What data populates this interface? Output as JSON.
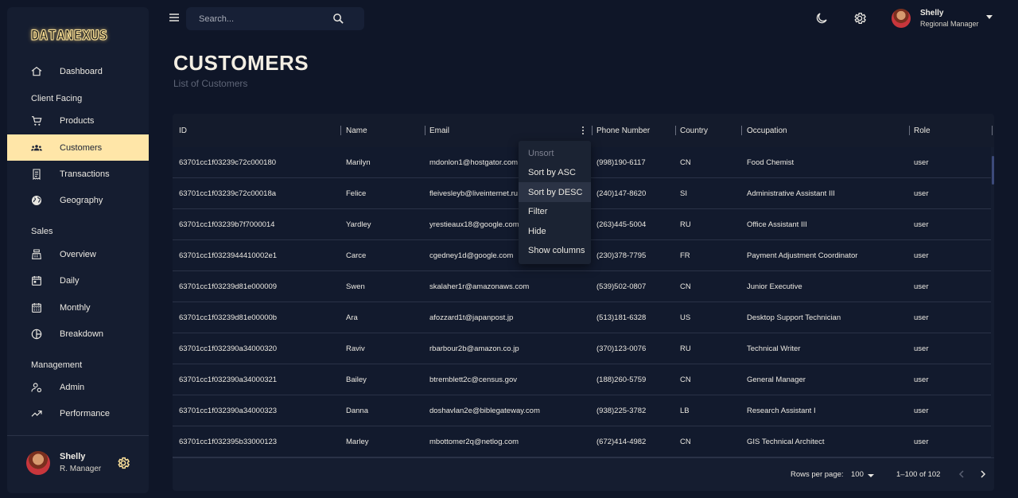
{
  "brand": {
    "logo_text": "DATANEXUS"
  },
  "sidebar": {
    "items": [
      {
        "type": "link",
        "label": "Dashboard",
        "icon": "home-icon"
      },
      {
        "type": "section",
        "label": "Client Facing"
      },
      {
        "type": "link",
        "label": "Products",
        "icon": "shopping-cart-icon"
      },
      {
        "type": "link",
        "label": "Customers",
        "icon": "groups-icon",
        "active": true
      },
      {
        "type": "link",
        "label": "Transactions",
        "icon": "receipt-icon"
      },
      {
        "type": "link",
        "label": "Geography",
        "icon": "globe-icon"
      },
      {
        "type": "section",
        "label": "Sales"
      },
      {
        "type": "link",
        "label": "Overview",
        "icon": "point-of-sale-icon"
      },
      {
        "type": "link",
        "label": "Daily",
        "icon": "calendar-today-icon"
      },
      {
        "type": "link",
        "label": "Monthly",
        "icon": "calendar-month-icon"
      },
      {
        "type": "link",
        "label": "Breakdown",
        "icon": "pie-chart-icon"
      },
      {
        "type": "section",
        "label": "Management"
      },
      {
        "type": "link",
        "label": "Admin",
        "icon": "admin-settings-icon"
      },
      {
        "type": "link",
        "label": "Performance",
        "icon": "trending-up-icon"
      }
    ],
    "user": {
      "name": "Shelly",
      "role": "R. Manager"
    }
  },
  "topbar": {
    "search_placeholder": "Search...",
    "user": {
      "name": "Shelly",
      "role": "Regional Manager"
    }
  },
  "page": {
    "title": "CUSTOMERS",
    "subtitle": "List of Customers"
  },
  "table": {
    "columns": [
      "ID",
      "Name",
      "Email",
      "Phone Number",
      "Country",
      "Occupation",
      "Role"
    ],
    "rows": [
      [
        "63701cc1f03239c72c000180",
        "Marilyn",
        "mdonlon1@hostgator.com",
        "(998)190-6117",
        "CN",
        "Food Chemist",
        "user"
      ],
      [
        "63701cc1f03239c72c00018a",
        "Felice",
        "fleivesleyb@liveinternet.ru",
        "(240)147-8620",
        "SI",
        "Administrative Assistant III",
        "user"
      ],
      [
        "63701cc1f03239b7f7000014",
        "Yardley",
        "yrestieaux18@google.com.hk",
        "(263)445-5004",
        "RU",
        "Office Assistant III",
        "user"
      ],
      [
        "63701cc1f0323944410002e1",
        "Carce",
        "cgedney1d@google.com",
        "(230)378-7795",
        "FR",
        "Payment Adjustment Coordinator",
        "user"
      ],
      [
        "63701cc1f03239d81e000009",
        "Swen",
        "skalaher1r@amazonaws.com",
        "(539)502-0807",
        "CN",
        "Junior Executive",
        "user"
      ],
      [
        "63701cc1f03239d81e00000b",
        "Ara",
        "afozzard1t@japanpost.jp",
        "(513)181-6328",
        "US",
        "Desktop Support Technician",
        "user"
      ],
      [
        "63701cc1f032390a34000320",
        "Raviv",
        "rbarbour2b@amazon.co.jp",
        "(370)123-0076",
        "RU",
        "Technical Writer",
        "user"
      ],
      [
        "63701cc1f032390a34000321",
        "Bailey",
        "btremblett2c@census.gov",
        "(188)260-5759",
        "CN",
        "General Manager",
        "user"
      ],
      [
        "63701cc1f032390a34000323",
        "Danna",
        "doshavlan2e@biblegateway.com",
        "(938)225-3782",
        "LB",
        "Research Assistant I",
        "user"
      ],
      [
        "63701cc1f032395b33000123",
        "Marley",
        "mbottomer2q@netlog.com",
        "(672)414-4982",
        "CN",
        "GIS Technical Architect",
        "user"
      ]
    ],
    "footer": {
      "rows_per_page_label": "Rows per page:",
      "rows_per_page_value": "100",
      "range": "1–100 of 102"
    }
  },
  "column_menu": {
    "items": [
      {
        "label": "Unsort",
        "disabled": true
      },
      {
        "label": "Sort by ASC"
      },
      {
        "label": "Sort by DESC",
        "highlighted": true
      },
      {
        "label": "Filter"
      },
      {
        "label": "Hide"
      },
      {
        "label": "Show columns"
      }
    ]
  }
}
